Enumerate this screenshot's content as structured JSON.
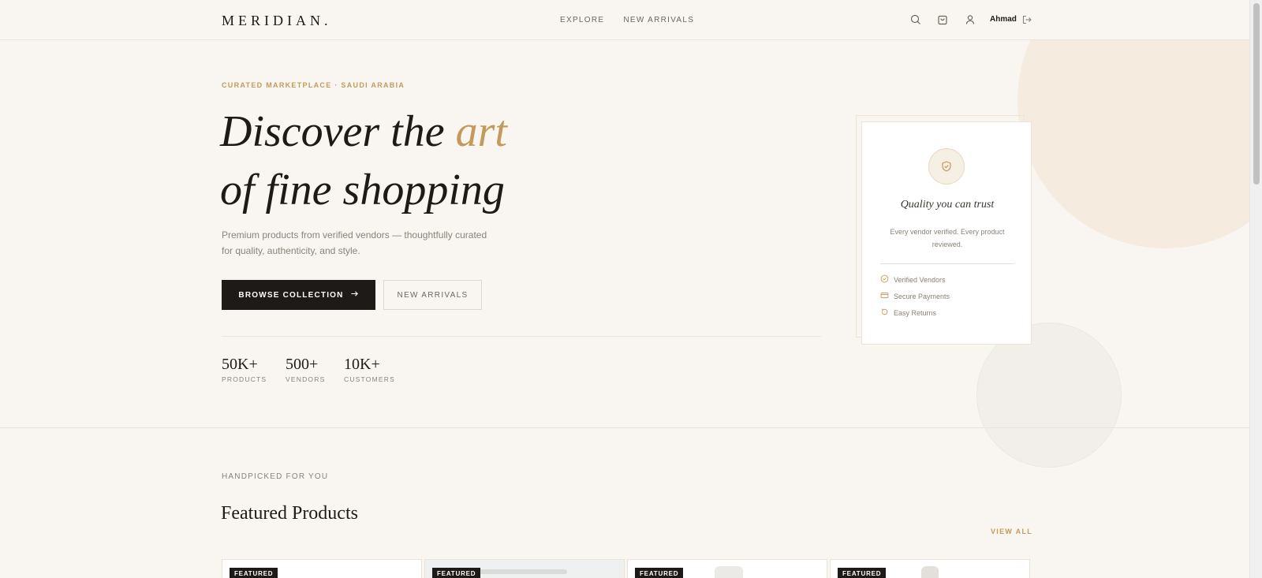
{
  "header": {
    "logo": "MERIDIAN.",
    "nav": [
      "EXPLORE",
      "NEW ARRIVALS"
    ],
    "user_name": "Ahmad",
    "icons": [
      "search-icon",
      "bag-icon",
      "user-icon",
      "logout-icon"
    ]
  },
  "hero": {
    "eyebrow": "CURATED MARKETPLACE · SAUDI ARABIA",
    "title_line1_prefix": "Discover the ",
    "title_line1_accent": "art",
    "title_line2": "of fine shopping",
    "subtitle": "Premium products from verified vendors — thoughtfully curated for quality, authenticity, and style.",
    "primary_button": "BROWSE COLLECTION",
    "secondary_button": "NEW ARRIVALS",
    "stats": [
      {
        "value": "50K+",
        "label": "PRODUCTS"
      },
      {
        "value": "500+",
        "label": "VENDORS"
      },
      {
        "value": "10K+",
        "label": "CUSTOMERS"
      }
    ]
  },
  "trust_card": {
    "title": "Quality you can trust",
    "description": "Every vendor verified. Every product reviewed.",
    "features": [
      "Verified Vendors",
      "Secure Payments",
      "Easy Returns"
    ]
  },
  "featured": {
    "eyebrow": "HANDPICKED FOR YOU",
    "title": "Featured Products",
    "view_all": "VIEW ALL",
    "badges": [
      "FEATURED",
      "FEATURED",
      "FEATURED",
      "FEATURED"
    ]
  },
  "colors": {
    "accent": "#c49a5a",
    "background": "#f9f6f1",
    "primary": "#1e1a17"
  }
}
